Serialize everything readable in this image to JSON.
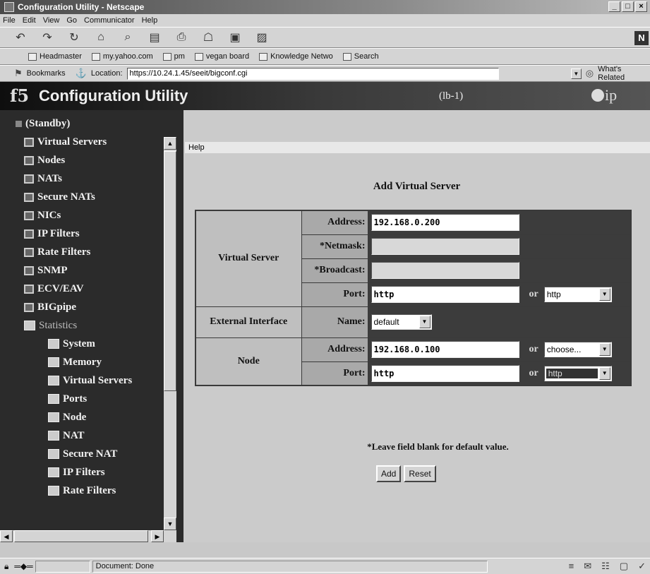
{
  "window": {
    "title": "Configuration Utility - Netscape",
    "controls": [
      "_",
      "□",
      "×"
    ]
  },
  "menu": [
    "File",
    "Edit",
    "View",
    "Go",
    "Communicator",
    "Help"
  ],
  "nav_toolbar": {
    "icons": [
      "back-icon",
      "forward-icon",
      "reload-icon",
      "home-icon",
      "search-icon",
      "my-netscape-icon",
      "print-icon",
      "security-icon",
      "shop-icon",
      "stop-icon"
    ],
    "brand": "N"
  },
  "personal_toolbar": {
    "items": [
      "Headmaster",
      "my.yahoo.com",
      "pm",
      "vegan board",
      "Knowledge Netwo",
      "Search"
    ]
  },
  "location_bar": {
    "bookmarks_label": "Bookmarks",
    "location_label": "Location:",
    "url": "https://10.24.1.45/seeit/bigconf.cgi",
    "related_label": "What's Related"
  },
  "banner": {
    "logo": "f5",
    "title": "Configuration Utility",
    "host": "(lb-1)",
    "brand": "ip"
  },
  "sidebar": {
    "items": [
      {
        "label": "(Standby)",
        "level": 0
      },
      {
        "label": "Virtual Servers",
        "level": 1
      },
      {
        "label": "Nodes",
        "level": 1
      },
      {
        "label": "NATs",
        "level": 1
      },
      {
        "label": "Secure NATs",
        "level": 1
      },
      {
        "label": "NICs",
        "level": 1
      },
      {
        "label": "IP Filters",
        "level": 1
      },
      {
        "label": "Rate Filters",
        "level": 1
      },
      {
        "label": "SNMP",
        "level": 1
      },
      {
        "label": "ECV/EAV",
        "level": 1
      },
      {
        "label": "BIGpipe",
        "level": 1
      },
      {
        "label": "Statistics",
        "level": 1
      },
      {
        "label": "System",
        "level": 2
      },
      {
        "label": "Memory",
        "level": 2
      },
      {
        "label": "Virtual Servers",
        "level": 2
      },
      {
        "label": "Ports",
        "level": 2
      },
      {
        "label": "Node",
        "level": 2
      },
      {
        "label": "NAT",
        "level": 2
      },
      {
        "label": "Secure NAT",
        "level": 2
      },
      {
        "label": "IP Filters",
        "level": 2
      },
      {
        "label": "Rate Filters",
        "level": 2
      }
    ]
  },
  "main": {
    "help_link": "Help",
    "heading": "Add Virtual Server",
    "form": {
      "virtual_server_group": "Virtual Server",
      "address_label": "Address:",
      "address_value": "192.168.0.200",
      "netmask_label": "*Netmask:",
      "netmask_value": "",
      "broadcast_label": "*Broadcast:",
      "broadcast_value": "",
      "port_label": "Port:",
      "port_value": "http",
      "or_label": "or",
      "port_select": "http",
      "external_group": "External Interface",
      "name_label": "Name:",
      "name_select": "default",
      "node_group": "Node",
      "node_address_label": "Address:",
      "node_address_value": "192.168.0.100",
      "node_address_select": "choose...",
      "node_port_label": "Port:",
      "node_port_value": "http",
      "node_port_select": "http"
    },
    "footnote": "*Leave field blank for default value.",
    "add_button": "Add",
    "reset_button": "Reset"
  },
  "statusbar": {
    "text": "Document: Done"
  }
}
